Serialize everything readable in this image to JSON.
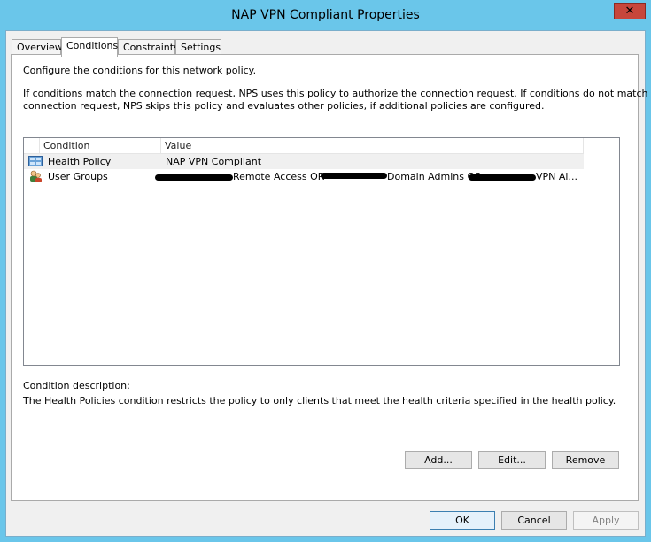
{
  "window": {
    "title": "NAP VPN Compliant Properties",
    "close_glyph": "✕"
  },
  "tabs": [
    {
      "label": "Overview"
    },
    {
      "label": "Conditions"
    },
    {
      "label": "Constraints"
    },
    {
      "label": "Settings"
    }
  ],
  "panel": {
    "intro": "Configure the conditions for this network policy.",
    "explain_line1": "If conditions match the connection request, NPS uses this policy to authorize the connection request. If conditions do not match the",
    "explain_line2": "connection request, NPS skips this policy and evaluates other policies, if additional policies are configured."
  },
  "list": {
    "columns": [
      "Condition",
      "Value"
    ],
    "rows": [
      {
        "icon": "health-policy-icon",
        "condition": "Health Policy",
        "value": "NAP VPN Compliant"
      },
      {
        "icon": "user-groups-icon",
        "condition": "User Groups",
        "value_parts": [
          "Remote Access OR",
          "Domain Admins OR",
          "VPN Al..."
        ]
      }
    ]
  },
  "description": {
    "label": "Condition description:",
    "text": "The Health Policies condition restricts the policy to only clients that meet the health criteria specified in the health policy."
  },
  "buttons": {
    "add": "Add...",
    "edit": "Edit...",
    "remove": "Remove",
    "ok": "OK",
    "cancel": "Cancel",
    "apply": "Apply"
  }
}
